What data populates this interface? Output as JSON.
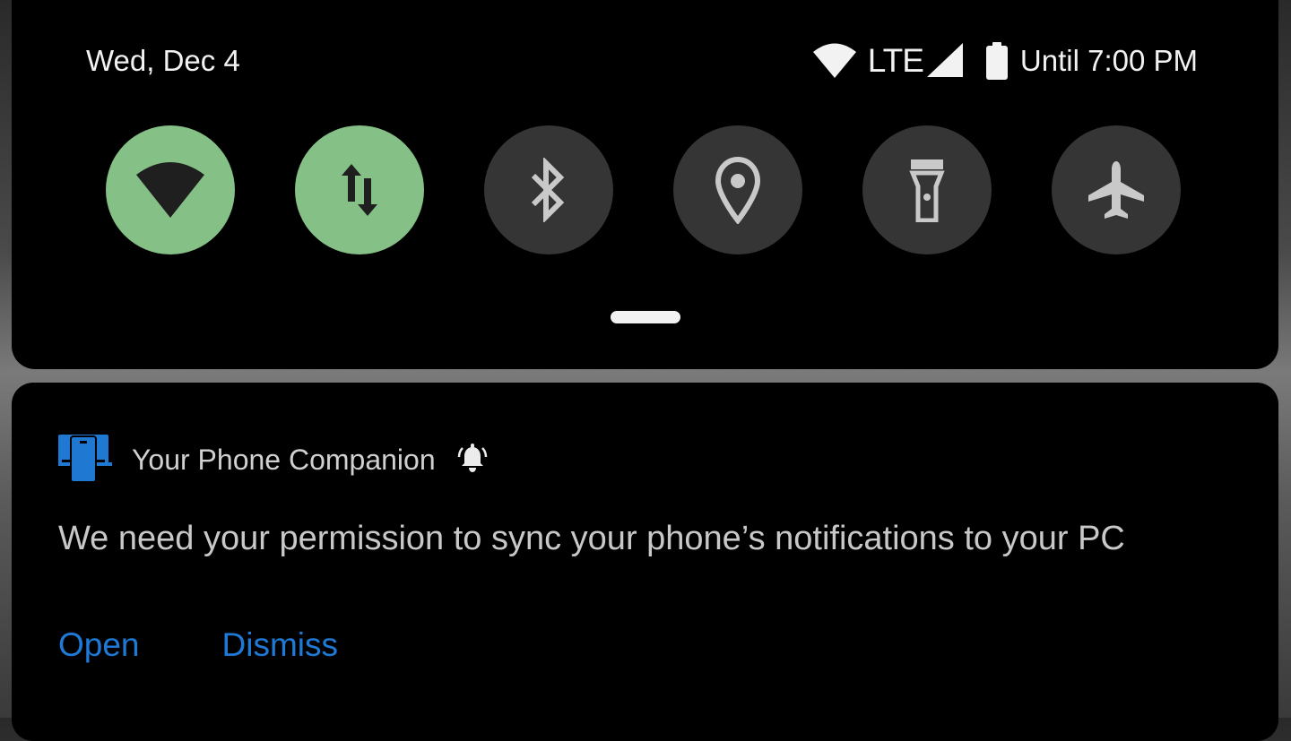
{
  "status_bar": {
    "date": "Wed, Dec 4",
    "network_label": "LTE",
    "battery_text": "Until 7:00 PM",
    "icons": [
      "wifi-icon",
      "cell-signal-icon",
      "battery-icon"
    ]
  },
  "quick_settings": {
    "tiles": [
      {
        "id": "wifi",
        "icon": "wifi-icon",
        "active": true,
        "bg": "#85c187"
      },
      {
        "id": "mobile-data",
        "icon": "data-arrows-icon",
        "active": true,
        "bg": "#85c187"
      },
      {
        "id": "bluetooth",
        "icon": "bluetooth-icon",
        "active": false,
        "bg": "#353535"
      },
      {
        "id": "location",
        "icon": "location-pin-icon",
        "active": false,
        "bg": "#353535"
      },
      {
        "id": "flashlight",
        "icon": "flashlight-icon",
        "active": false,
        "bg": "#353535"
      },
      {
        "id": "airplane-mode",
        "icon": "airplane-icon",
        "active": false,
        "bg": "#353535"
      }
    ],
    "active_icon_color": "#1f1f1f",
    "inactive_icon_color": "#c9c9c9"
  },
  "notification": {
    "app_icon": "phone-companion-icon",
    "app_name": "Your Phone Companion",
    "alert_icon": "bell-alert-icon",
    "message": "We need your permission to sync your phone’s notifications to your PC",
    "actions": [
      {
        "label": "Open"
      },
      {
        "label": "Dismiss"
      }
    ],
    "accent_color": "#1e7ad6"
  }
}
